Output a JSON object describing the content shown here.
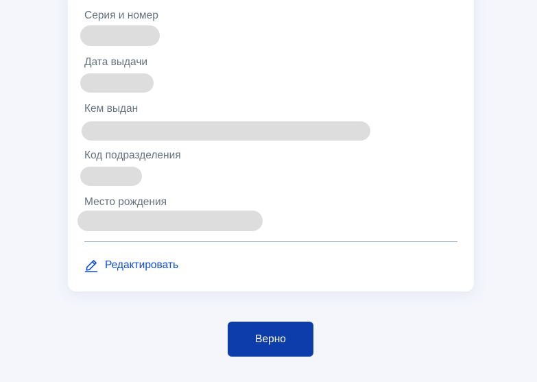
{
  "card": {
    "fields": [
      {
        "label": "Серия и номер"
      },
      {
        "label": "Дата выдачи"
      },
      {
        "label": "Кем выдан"
      },
      {
        "label": "Код подразделения"
      },
      {
        "label": "Место рождения"
      }
    ],
    "edit_label": "Редактировать",
    "edit_icon": "pencil-icon"
  },
  "confirm_label": "Верно",
  "colors": {
    "background": "#f4f6fc",
    "card": "#ffffff",
    "label": "#66727f",
    "placeholder": "#dddddd",
    "link": "#0d4cd3",
    "button": "#0d3cab",
    "button_text": "#ffffff"
  }
}
